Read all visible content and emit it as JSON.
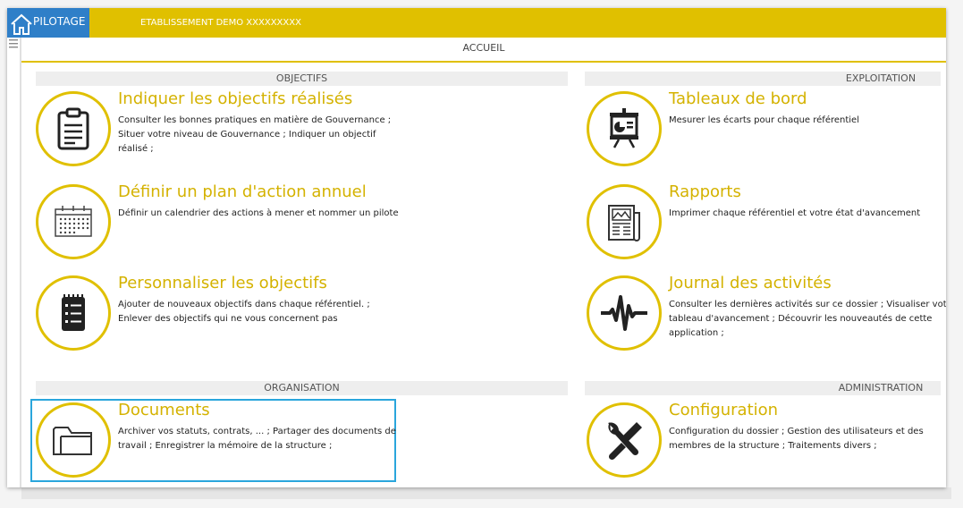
{
  "header": {
    "home_label": "PILOTAGE",
    "establishment": "ETABLISSEMENT DEMO XXXXXXXXX",
    "page_title": "ACCUEIL"
  },
  "sections": {
    "objectifs": "OBJECTIFS",
    "exploitation": "EXPLOITATION",
    "organisation": "ORGANISATION",
    "administration": "ADMINISTRATION"
  },
  "items": {
    "objectifs_realises": {
      "title": "Indiquer les objectifs réalisés",
      "desc": "Consulter les bonnes pratiques en matière de Gouvernance ; Situer votre niveau de Gouvernance ; Indiquer un objectif réalisé ;",
      "icon": "clipboard-icon"
    },
    "plan_action": {
      "title": "Définir un plan d'action annuel",
      "desc": "Définir un calendrier des actions à mener et nommer un pilote",
      "icon": "calendar-icon"
    },
    "personnaliser": {
      "title": "Personnaliser les objectifs",
      "desc": "Ajouter de nouveaux objectifs dans chaque référentiel. ; Enlever des objectifs qui ne vous concernent pas",
      "icon": "checklist-icon"
    },
    "tableaux_bord": {
      "title": "Tableaux de bord",
      "desc": "Mesurer les écarts pour chaque référentiel",
      "icon": "presentation-board-icon"
    },
    "rapports": {
      "title": "Rapports",
      "desc": "Imprimer chaque référentiel et votre état d'avancement",
      "icon": "newspaper-icon"
    },
    "journal": {
      "title": "Journal des activités",
      "desc": "Consulter les dernières activités sur ce dossier ; Visualiser votre tableau d'avancement ; Découvrir les nouveautés de cette application ;",
      "icon": "activity-pulse-icon"
    },
    "documents": {
      "title": "Documents",
      "desc": "Archiver vos statuts, contrats, ... ; Partager des documents de travail ; Enregistrer la mémoire de la structure ;",
      "icon": "folder-icon"
    },
    "configuration": {
      "title": "Configuration",
      "desc": "Configuration du dossier ; Gestion des utilisateurs et des membres de la structure ; Traitements divers ;",
      "icon": "tools-icon"
    }
  },
  "colors": {
    "accent_yellow": "#e0c000",
    "title_yellow": "#d4b200",
    "home_blue": "#2f7fc8",
    "selection_blue": "#2aa6dc"
  }
}
